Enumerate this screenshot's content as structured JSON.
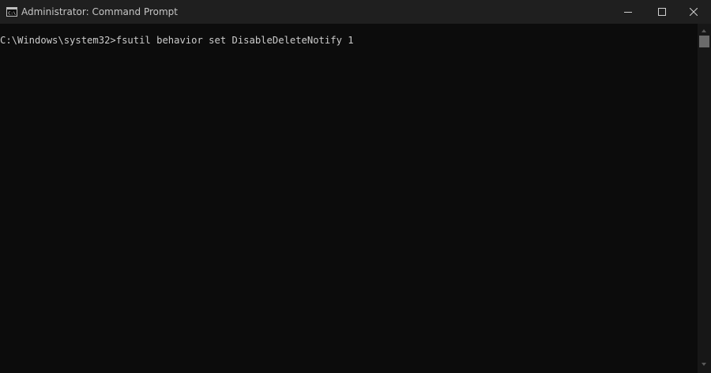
{
  "window": {
    "title": "Administrator: Command Prompt",
    "icons": {
      "app": "command-prompt-icon",
      "minimize": "minimize-icon",
      "maximize": "maximize-icon",
      "close": "close-icon"
    }
  },
  "console": {
    "lines": [
      "C:\\Windows\\system32>fsutil behavior set DisableDeleteNotify 1"
    ],
    "text_color": "#cccccc",
    "background": "#0c0c0c"
  },
  "colors": {
    "titlebar": "#1f1f1f",
    "title_text": "#c6c6c6",
    "scrollbar_track": "#171717",
    "scrollbar_thumb": "#6a6a6a"
  }
}
